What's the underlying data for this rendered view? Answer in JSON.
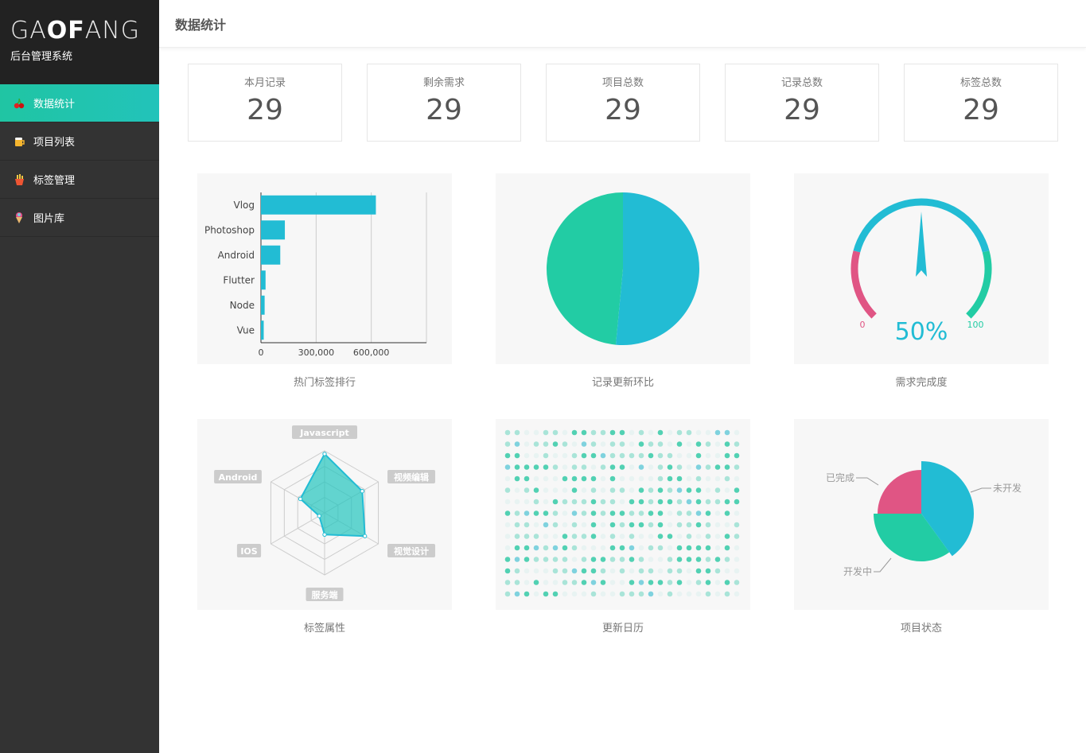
{
  "brand": {
    "logo_light1": "GA",
    "logo_bold": "OF",
    "logo_light2": "ANG",
    "subtitle": "后台管理系统"
  },
  "sidebar": {
    "items": [
      {
        "label": "数据统计",
        "icon": "cherry-icon",
        "active": true
      },
      {
        "label": "项目列表",
        "icon": "beer-icon",
        "active": false
      },
      {
        "label": "标签管理",
        "icon": "fries-icon",
        "active": false
      },
      {
        "label": "图片库",
        "icon": "icecream-icon",
        "active": false
      }
    ]
  },
  "header": {
    "title": "数据统计"
  },
  "stats": [
    {
      "label": "本月记录",
      "value": "29"
    },
    {
      "label": "剩余需求",
      "value": "29"
    },
    {
      "label": "项目总数",
      "value": "29"
    },
    {
      "label": "记录总数",
      "value": "29"
    },
    {
      "label": "标签总数",
      "value": "29"
    }
  ],
  "colors": {
    "accent": "#22bcd4",
    "teal": "#22cca4",
    "pink": "#e05584"
  },
  "chart_data": [
    {
      "type": "bar",
      "orientation": "horizontal",
      "caption": "热门标签排行",
      "categories": [
        "Vlog",
        "Photoshop",
        "Android",
        "Flutter",
        "Node",
        "Vue"
      ],
      "values": [
        625000,
        130000,
        105000,
        25000,
        20000,
        15000
      ],
      "xlim": [
        0,
        900000
      ],
      "xticks": [
        "0",
        "300,000",
        "600,000"
      ],
      "grid": true
    },
    {
      "type": "pie",
      "caption": "记录更新环比",
      "slices": [
        {
          "value": 51.5,
          "color": "#22bcd4"
        },
        {
          "value": 48.5,
          "color": "#22cca4"
        }
      ]
    },
    {
      "type": "gauge",
      "caption": "需求完成度",
      "value": 50,
      "min_label": "0",
      "max_label": "100",
      "value_label": "50%"
    },
    {
      "type": "radar",
      "caption": "标签属性",
      "indicators": [
        "Javascript",
        "视频编辑",
        "视觉设计",
        "服务端",
        "IOS",
        "Android"
      ],
      "values": [
        0.95,
        0.7,
        0.75,
        0.35,
        0.1,
        0.45
      ]
    },
    {
      "type": "heatmap",
      "caption": "更新日历",
      "rows": 15,
      "cols": 25
    },
    {
      "type": "pie",
      "caption": "项目状态",
      "slices": [
        {
          "name": "未开发",
          "value": 40,
          "color": "#22bcd4"
        },
        {
          "name": "开发中",
          "value": 35,
          "color": "#22cca4"
        },
        {
          "name": "已完成",
          "value": 25,
          "color": "#e05584"
        }
      ]
    }
  ]
}
